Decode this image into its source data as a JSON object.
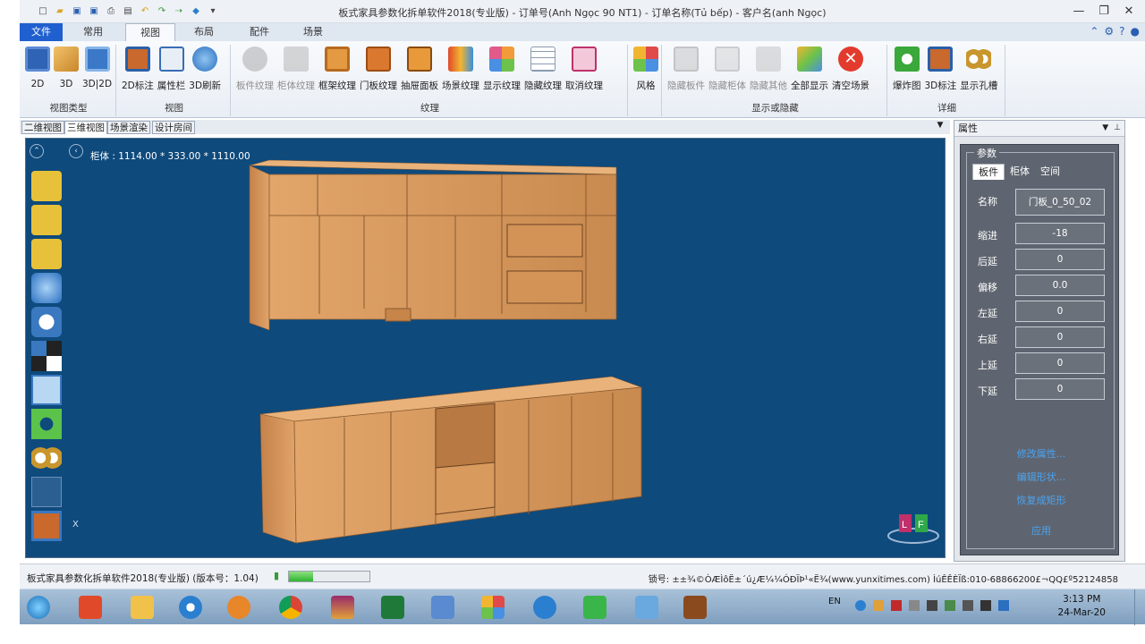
{
  "window": {
    "title": "板式家具参数化拆单软件2018(专业版) - 订单号(Anh Ngọc 90 NT1) - 订单名称(Tủ bếp) - 客户名(anh Ngọc)",
    "controls": [
      "—",
      "❐",
      "✕"
    ]
  },
  "menu_tabs": [
    {
      "label": "文件"
    },
    {
      "label": "常用"
    },
    {
      "label": "视图"
    },
    {
      "label": "布局"
    },
    {
      "label": "配件"
    },
    {
      "label": "场景"
    }
  ],
  "ribbon": {
    "groups": [
      {
        "label": "视图类型",
        "buttons": [
          "2D",
          "3D",
          "3D|2D"
        ]
      },
      {
        "label": "视图",
        "buttons": [
          "2D标注",
          "属性栏",
          "3D刷新"
        ]
      },
      {
        "label": "纹理",
        "buttons": [
          "板件纹理",
          "柜体纹理",
          "框架纹理",
          "门板纹理",
          "抽屉面板",
          "场景纹理",
          "显示纹理",
          "隐藏纹理",
          "取消纹理"
        ]
      },
      {
        "label": "",
        "buttons": [
          "风格"
        ]
      },
      {
        "label": "显示或隐藏",
        "buttons": [
          "隐藏板件",
          "隐藏柜体",
          "隐藏其他",
          "全部显示",
          "清空场景"
        ]
      },
      {
        "label": "详细",
        "buttons": [
          "爆炸图",
          "3D标注",
          "显示孔槽"
        ]
      }
    ]
  },
  "doc_tabs": [
    "二维视图",
    "三维视图",
    "场景渲染",
    "设计房间"
  ],
  "viewport": {
    "dims": "柜体 : 1114.00 * 333.00 * 1110.00",
    "axis_label": "X",
    "badge_letters": [
      "L",
      "F"
    ]
  },
  "panel": {
    "title": "属性",
    "fieldset": "参数",
    "tabs": [
      "板件",
      "柜体",
      "空间"
    ],
    "rows": [
      {
        "label": "名称",
        "value": "门板_0_50_02"
      },
      {
        "label": "缩进",
        "value": "-18"
      },
      {
        "label": "后延",
        "value": "0"
      },
      {
        "label": "偏移",
        "value": "0.0"
      },
      {
        "label": "左延",
        "value": "0"
      },
      {
        "label": "右延",
        "value": "0"
      },
      {
        "label": "上延",
        "value": "0"
      },
      {
        "label": "下延",
        "value": "0"
      }
    ],
    "links": [
      "修改属性...",
      "编辑形状...",
      "恢复成矩形"
    ],
    "apply": "应用"
  },
  "status": {
    "left": "板式家具参数化拆单软件2018(专业版) (版本号：1.04)",
    "progress": 0.3,
    "right": "锁号: ±±¾©ÒÆÌôË±´ú¿Æ¼¼ÓÐÏÞ¹«Ë¾(www.yunxitimes.com)  ÌúÊÊÈÏß:010-68866200£¬QQ£º52124858"
  },
  "taskbar": {
    "lang": "EN",
    "time": "3:13 PM",
    "date": "24-Mar-20"
  },
  "colors": {
    "accent": "#1f5fcf",
    "viewport_bg": "#0e4a7c",
    "wood": "#d89a5e",
    "panel_bg": "#5f6570"
  }
}
